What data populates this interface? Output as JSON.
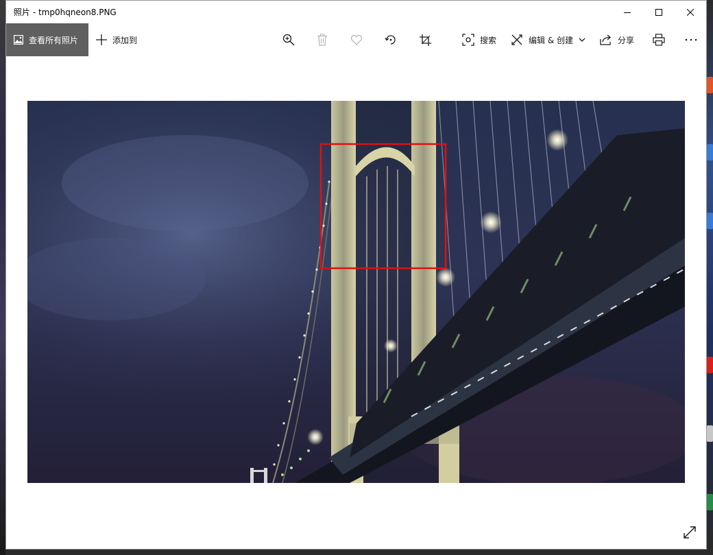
{
  "window": {
    "title": "照片 - tmp0hqneon8.PNG"
  },
  "toolbar": {
    "view_all_label": "查看所有照片",
    "add_to_label": "添加到",
    "search_label": "搜索",
    "edit_create_label": "编辑 & 创建",
    "share_label": "分享"
  },
  "icons": {
    "view_all": "image-icon",
    "add_to": "plus-icon",
    "zoom": "zoom-in-icon",
    "delete": "trash-icon",
    "favorite": "heart-icon",
    "rotate": "rotate-icon",
    "crop": "crop-icon",
    "search": "visual-search-icon",
    "edit": "edit-create-icon",
    "share": "share-icon",
    "print": "printer-icon",
    "more": "more-icon",
    "fullscreen": "expand-icon"
  },
  "colors": {
    "accent_view_all": "#5f5f5f",
    "annotation_box": "#e01010"
  }
}
